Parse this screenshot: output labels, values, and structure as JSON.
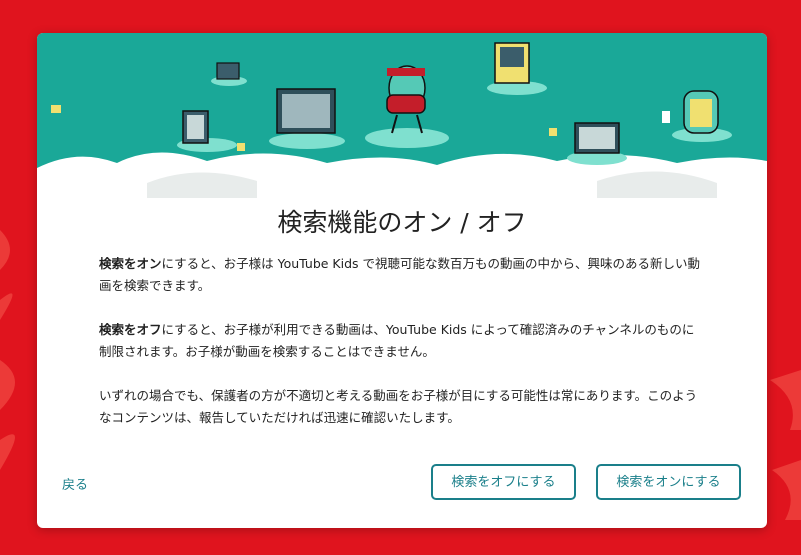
{
  "dialog": {
    "title": "検索機能のオン / オフ",
    "para1_bold": "検索をオン",
    "para1_rest": "にすると、お子様は YouTube Kids で視聴可能な数百万もの動画の中から、興味のある新しい動画を検索できます。",
    "para2_bold": "検索をオフ",
    "para2_rest": "にすると、お子様が利用できる動画は、YouTube Kids によって確認済みのチャンネルのものに制限されます。お子様が動画を検索することはできません。",
    "para3": "いずれの場合でも、保護者の方が不適切と考える動画をお子様が目にする可能性は常にあります。このようなコンテンツは、報告していただければ迅速に確認いたします。"
  },
  "actions": {
    "back_label": "戻る",
    "search_off_label": "検索をオフにする",
    "search_on_label": "検索をオンにする"
  },
  "colors": {
    "background": "#e0141e",
    "accent": "#1a7f8a",
    "hero_teal": "#1aa898"
  }
}
